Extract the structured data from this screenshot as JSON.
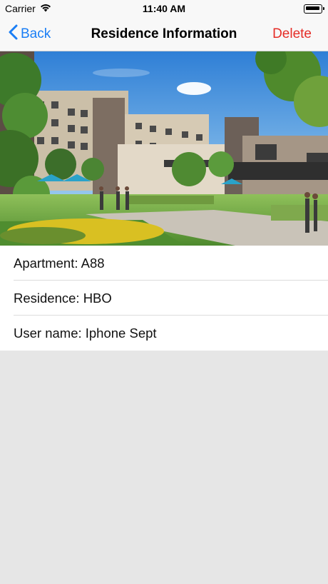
{
  "status_bar": {
    "carrier": "Carrier",
    "time": "11:40 AM",
    "icons": [
      "wifi-icon",
      "battery-icon"
    ]
  },
  "nav": {
    "back_label": "Back",
    "title": "Residence Information",
    "delete_label": "Delete",
    "icons": [
      "chevron-left-icon"
    ],
    "colors": {
      "accent": "#1a7ef5",
      "destructive": "#e52d27"
    }
  },
  "hero": {
    "image": "residence-building-photo"
  },
  "info": {
    "rows": [
      {
        "text": "Apartment: A88"
      },
      {
        "text": "Residence: HBO"
      },
      {
        "text": "User name: Iphone Sept"
      }
    ]
  }
}
